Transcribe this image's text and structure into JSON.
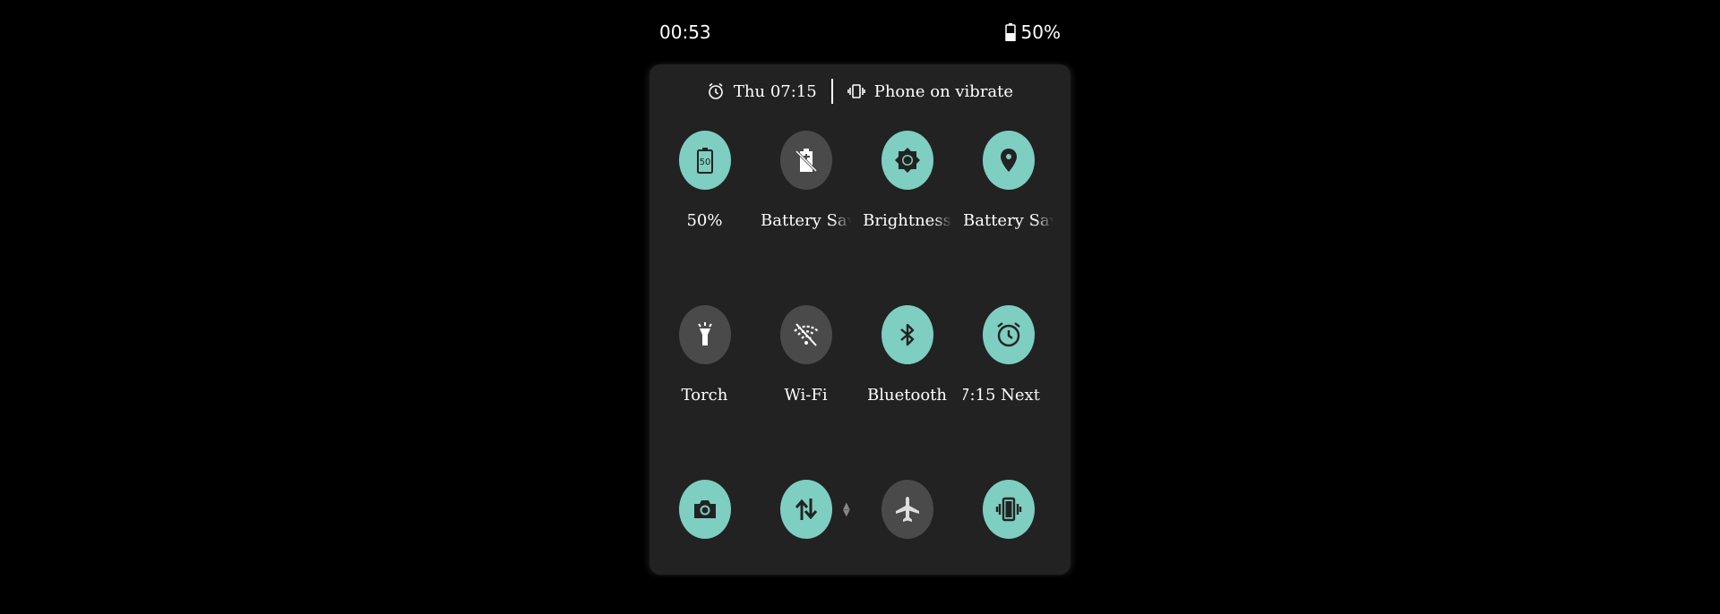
{
  "status_bar": {
    "time": "00:53",
    "battery_percent": "50%"
  },
  "header": {
    "alarm": "Thu 07:15",
    "ringer": "Phone on vibrate"
  },
  "colors": {
    "tile_on": "#7ecec2",
    "tile_off": "#4a4a4a",
    "panel_bg": "#222222"
  },
  "tiles": [
    {
      "label": "50%",
      "icon": "battery-50-icon",
      "state": "on"
    },
    {
      "label": "Battery Saver",
      "icon": "battery-saver-off-icon",
      "state": "off"
    },
    {
      "label": "Brightness",
      "icon": "brightness-icon",
      "state": "on"
    },
    {
      "label": "Battery Saver",
      "icon": "location-pin-icon",
      "state": "on"
    },
    {
      "label": "Torch",
      "icon": "flashlight-icon",
      "state": "off"
    },
    {
      "label": "Wi-Fi",
      "icon": "wifi-off-icon",
      "state": "off"
    },
    {
      "label": "Bluetooth",
      "icon": "bluetooth-icon",
      "state": "on"
    },
    {
      "label": "7:15     Next",
      "icon": "alarm-clock-icon",
      "state": "on"
    },
    {
      "label": "",
      "icon": "camera-icon",
      "state": "on"
    },
    {
      "label": "",
      "icon": "mobile-data-icon",
      "state": "on"
    },
    {
      "label": "",
      "icon": "airplane-icon",
      "state": "off"
    },
    {
      "label": "",
      "icon": "vibrate-icon",
      "state": "on"
    }
  ]
}
